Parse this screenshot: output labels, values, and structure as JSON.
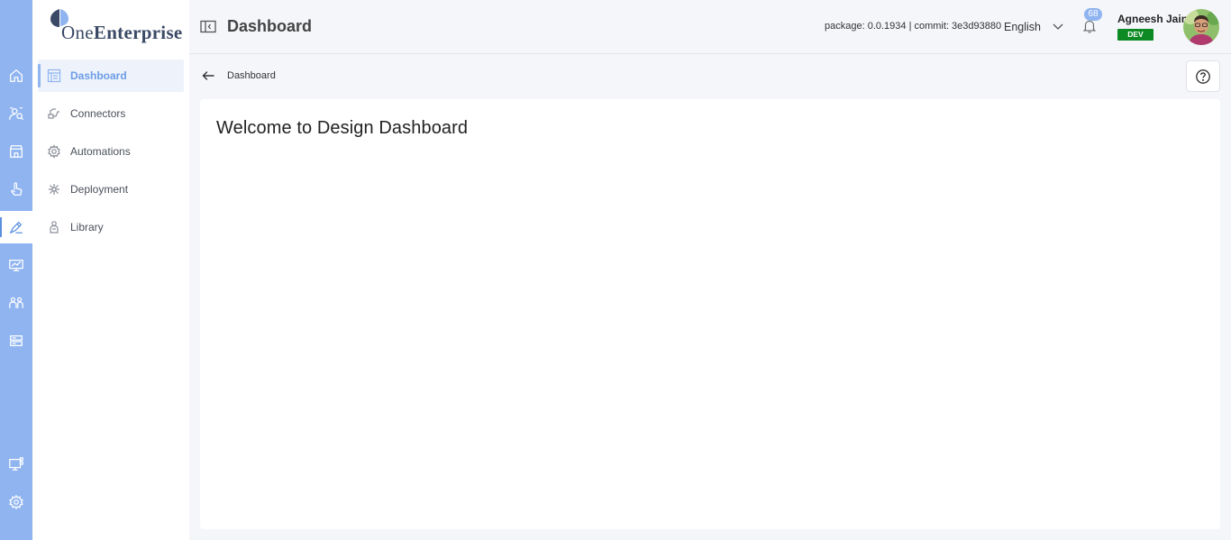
{
  "brand": {
    "name_prefix": "One",
    "name_suffix": "Enterprise",
    "accent_color": "#8fb4f0",
    "rail_color": "#8fb4f0"
  },
  "rail": {
    "items": [
      {
        "icon": "home-icon",
        "active": false
      },
      {
        "icon": "users-search-icon",
        "active": false
      },
      {
        "icon": "store-icon",
        "active": false
      },
      {
        "icon": "hand-pointer-icon",
        "active": false
      },
      {
        "icon": "design-pen-icon",
        "active": true
      },
      {
        "icon": "monitor-chart-icon",
        "active": false
      },
      {
        "icon": "people-icon",
        "active": false
      },
      {
        "icon": "server-icon",
        "active": false
      }
    ],
    "bottom_items": [
      {
        "icon": "remote-desktop-icon"
      },
      {
        "icon": "settings-icon"
      }
    ]
  },
  "sidebar": {
    "items": [
      {
        "label": "Dashboard",
        "icon": "dashboard-icon",
        "active": true
      },
      {
        "label": "Connectors",
        "icon": "connectors-icon",
        "active": false
      },
      {
        "label": "Automations",
        "icon": "automations-icon",
        "active": false
      },
      {
        "label": "Deployment",
        "icon": "deployment-icon",
        "active": false
      },
      {
        "label": "Library",
        "icon": "library-icon",
        "active": false
      }
    ]
  },
  "header": {
    "title": "Dashboard",
    "build_info": "package: 0.0.1934 | commit: 3e3d93880",
    "language": "English",
    "notification_count": "68",
    "user_name": "Agneesh Jain",
    "environment": "DEV",
    "environment_color": "#0d8a24"
  },
  "breadcrumb": {
    "current": "Dashboard"
  },
  "main": {
    "welcome_title": "Welcome to Design Dashboard"
  }
}
